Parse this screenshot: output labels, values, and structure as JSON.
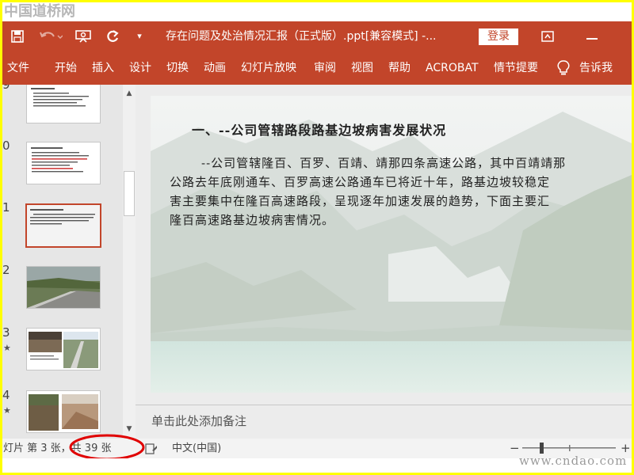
{
  "watermark_top": "中国道桥网",
  "watermark_bottom": "www.cndao.com",
  "titlebar": {
    "document_title": "存在问题及处治情况汇报（正式版）.ppt[兼容模式] -...",
    "login_label": "登录",
    "icons": [
      "save-icon",
      "undo-icon",
      "present-from-start-icon",
      "redo-icon",
      "customize-qat-icon",
      "ribbon-display-icon",
      "minimize-icon"
    ]
  },
  "ribbon": {
    "tabs": [
      "文件",
      "开始",
      "插入",
      "设计",
      "切换",
      "动画",
      "幻灯片放映",
      "审阅",
      "视图",
      "帮助",
      "ACROBAT",
      "情节提要"
    ],
    "tell_me": "告诉我"
  },
  "thumbnails": [
    {
      "number": "9",
      "starred": false
    },
    {
      "number": "0",
      "starred": false
    },
    {
      "number": "1",
      "starred": false
    },
    {
      "number": "2",
      "starred": false
    },
    {
      "number": "3",
      "starred": true
    },
    {
      "number": "4",
      "starred": true
    }
  ],
  "slide": {
    "heading": "一、--公司管辖路段路基边坡病害发展状况",
    "lines": [
      "--公司管辖隆百、百罗、百靖、靖那四条高速公路，其中百靖靖那",
      "公路去年底刚通车、百罗高速公路通车已将近十年，路基边坡较稳定",
      "害主要集中在隆百高速路段，呈现逐年加速发展的趋势，下面主要汇",
      "隆百高速路基边坡病害情况。"
    ]
  },
  "notes_placeholder": "单击此处添加备注",
  "statusbar": {
    "slide_counter": "幻灯片 第 3 张，共 39 张",
    "language": "中文(中国)",
    "zoom_minus": "−",
    "zoom_plus": "+"
  },
  "colors": {
    "accent": "#c2452a",
    "highlight_frame": "#ffff00",
    "annotation_circle": "#e00000"
  }
}
